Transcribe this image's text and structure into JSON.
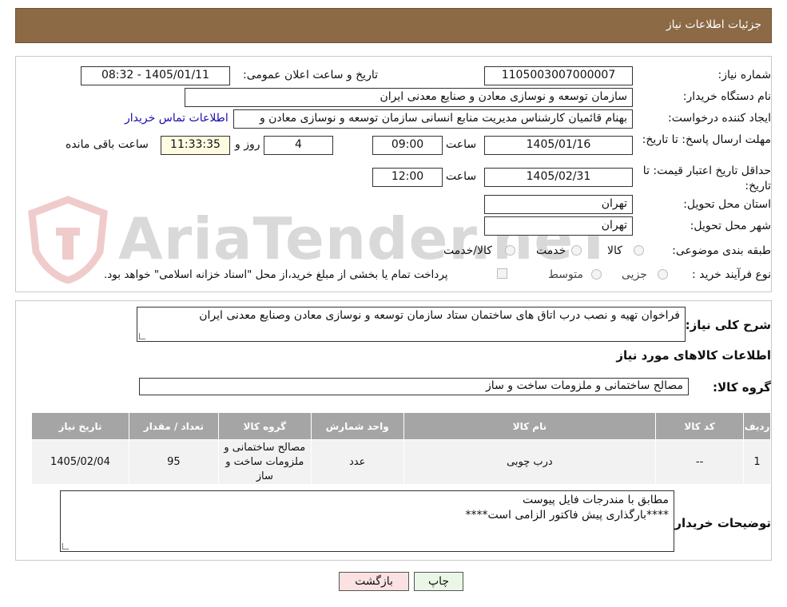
{
  "header": {
    "title": "جزئیات اطلاعات نیاز"
  },
  "fields": {
    "need_number_label": "شماره نیاز:",
    "need_number": "1105003007000007",
    "announce_label": "تاریخ و ساعت اعلان عمومی:",
    "announce_value": "1405/01/11 - 08:32",
    "buyer_label": "نام دستگاه خریدار:",
    "buyer_value": "سازمان توسعه و نوسازی معادن و صنایع معدنی ایران",
    "creator_label": "ایجاد کننده درخواست:",
    "creator_value": "بهنام قائمیان کارشناس مدیریت منابع انسانی سازمان توسعه و نوسازی معادن و",
    "contact_link": "اطلاعات تماس خریدار",
    "deadline_label": "مهلت ارسال پاسخ: تا تاریخ:",
    "deadline_date": "1405/01/16",
    "time_label": "ساعت",
    "deadline_time": "09:00",
    "days_value": "4",
    "days_label": "روز و",
    "remaining_time": "11:33:35",
    "remaining_label": "ساعت باقی مانده",
    "validity_label": "حداقل تاریخ اعتبار قیمت: تا تاریخ:",
    "validity_date": "1405/02/31",
    "validity_time": "12:00",
    "province_label": "استان محل تحویل:",
    "province_value": "تهران",
    "city_label": "شهر محل تحویل:",
    "city_value": "تهران",
    "category_label": "طبقه بندی موضوعی:",
    "category_options": [
      "کالا",
      "خدمت",
      "کالا/خدمت"
    ],
    "process_label": "نوع فرآیند خرید :",
    "process_options": [
      "جزیی",
      "متوسط"
    ],
    "payment_note": "پرداخت تمام یا بخشی از مبلغ خرید،از محل \"اسناد خزانه اسلامی\" خواهد بود."
  },
  "description": {
    "label": "شرح کلی نیاز:",
    "value": "فراخوان تهیه و نصب درب اتاق های ساختمان ستاد سازمان توسعه و نوسازی معادن وصنایع معدنی ایران"
  },
  "goods_section": {
    "title": "اطلاعات کالاهای مورد نیاز",
    "group_label": "گروه کالا:",
    "group_value": "مصالح ساختمانی و ملزومات ساخت و ساز"
  },
  "table": {
    "headers": [
      "ردیف",
      "کد کالا",
      "نام کالا",
      "واحد شمارش",
      "گروه کالا",
      "تعداد / مقدار",
      "تاریخ نیاز"
    ],
    "rows": [
      [
        "1",
        "--",
        "درب چوبی",
        "عدد",
        "مصالح ساختمانی و ملزومات ساخت و ساز",
        "95",
        "1405/02/04"
      ]
    ]
  },
  "buyer_notes": {
    "label": "توضیحات خریدار:",
    "line1": "مطابق با مندرجات فایل پیوست",
    "line2": "****بارگذاری پیش فاکتور الزامی است****"
  },
  "buttons": {
    "print": "چاپ",
    "back": "بازگشت"
  },
  "watermark": {
    "text": "AriaTender.neT"
  }
}
